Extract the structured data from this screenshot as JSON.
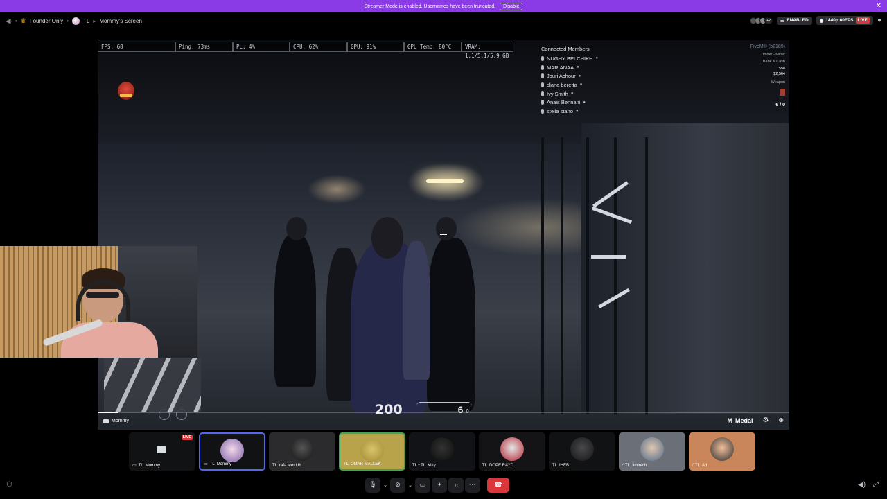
{
  "banner": {
    "message": "Streamer Mode is enabled. Usernames have been truncated.",
    "disable_label": "Disable",
    "close_icon": "close-icon"
  },
  "header": {
    "server": "Founder Only",
    "user_tag": "TL",
    "screen_title": "Mommy's Screen",
    "enabled_label": "ENABLED",
    "quality_label": "1440p 60FPS",
    "live_label": "LIVE",
    "viewer_extra": "+2"
  },
  "stream": {
    "stats": [
      {
        "label": "FPS: 68"
      },
      {
        "label": "Ping: 73ms"
      },
      {
        "label": "PL: 4%"
      },
      {
        "label": "CPU: 62%"
      },
      {
        "label": "GPU: 91%"
      },
      {
        "label": "GPU Temp: 80°C"
      },
      {
        "label": "VRAM: 1.1/5.1/5.9 GB"
      }
    ],
    "members_title": "Connected Members",
    "members": [
      "NUGHY BELCHIKH",
      "MARIANAA",
      "Jouri Achour",
      "diana beretta",
      "Ivy Smith",
      "Anais Bennani",
      "stella stano"
    ],
    "hud_right": {
      "brand": "FiveM® (b2189)",
      "job": "miner - Miner",
      "bank_label": "Bank & Cash",
      "cash": "$58",
      "bank": "$2,564",
      "weapon_label": "Weapon",
      "ammo": "6 / 0"
    },
    "health": "200",
    "ammo_count": "6",
    "ammo_reserve": "0",
    "overlay_name": "Mommy",
    "progress": 0.03,
    "medal_label": "Medal"
  },
  "tiles": [
    {
      "tag": "TL",
      "name": "Mommy",
      "live": "LIVE",
      "color": "#1a1b20"
    },
    {
      "tag": "TL",
      "name": "Mommy",
      "color": "#5a4b8a"
    },
    {
      "tag": "TL",
      "name": "rafa lemridh",
      "color": "#2b2b2e"
    },
    {
      "tag": "TL",
      "name": "OMAR MALLEK",
      "color": "#b8a24a"
    },
    {
      "tag": "TL • TL",
      "name": "Kitty",
      "color": "#121316"
    },
    {
      "tag": "TL",
      "name": "DOPE RAYD",
      "color": "#141416"
    },
    {
      "tag": "TL",
      "name": "IHEB",
      "color": "#111214"
    },
    {
      "tag": "TL",
      "name": "3mirech",
      "color": "#6b6f78"
    },
    {
      "tag": "TL",
      "name": "Ad",
      "color": "#c8865a"
    }
  ],
  "controls": {
    "mic": "mic-icon",
    "camera": "camera-off-icon",
    "screen": "screen-share-icon",
    "activities": "activities-icon",
    "soundboard": "soundboard-icon",
    "more": "more-icon",
    "leave": "leave-call-icon"
  }
}
